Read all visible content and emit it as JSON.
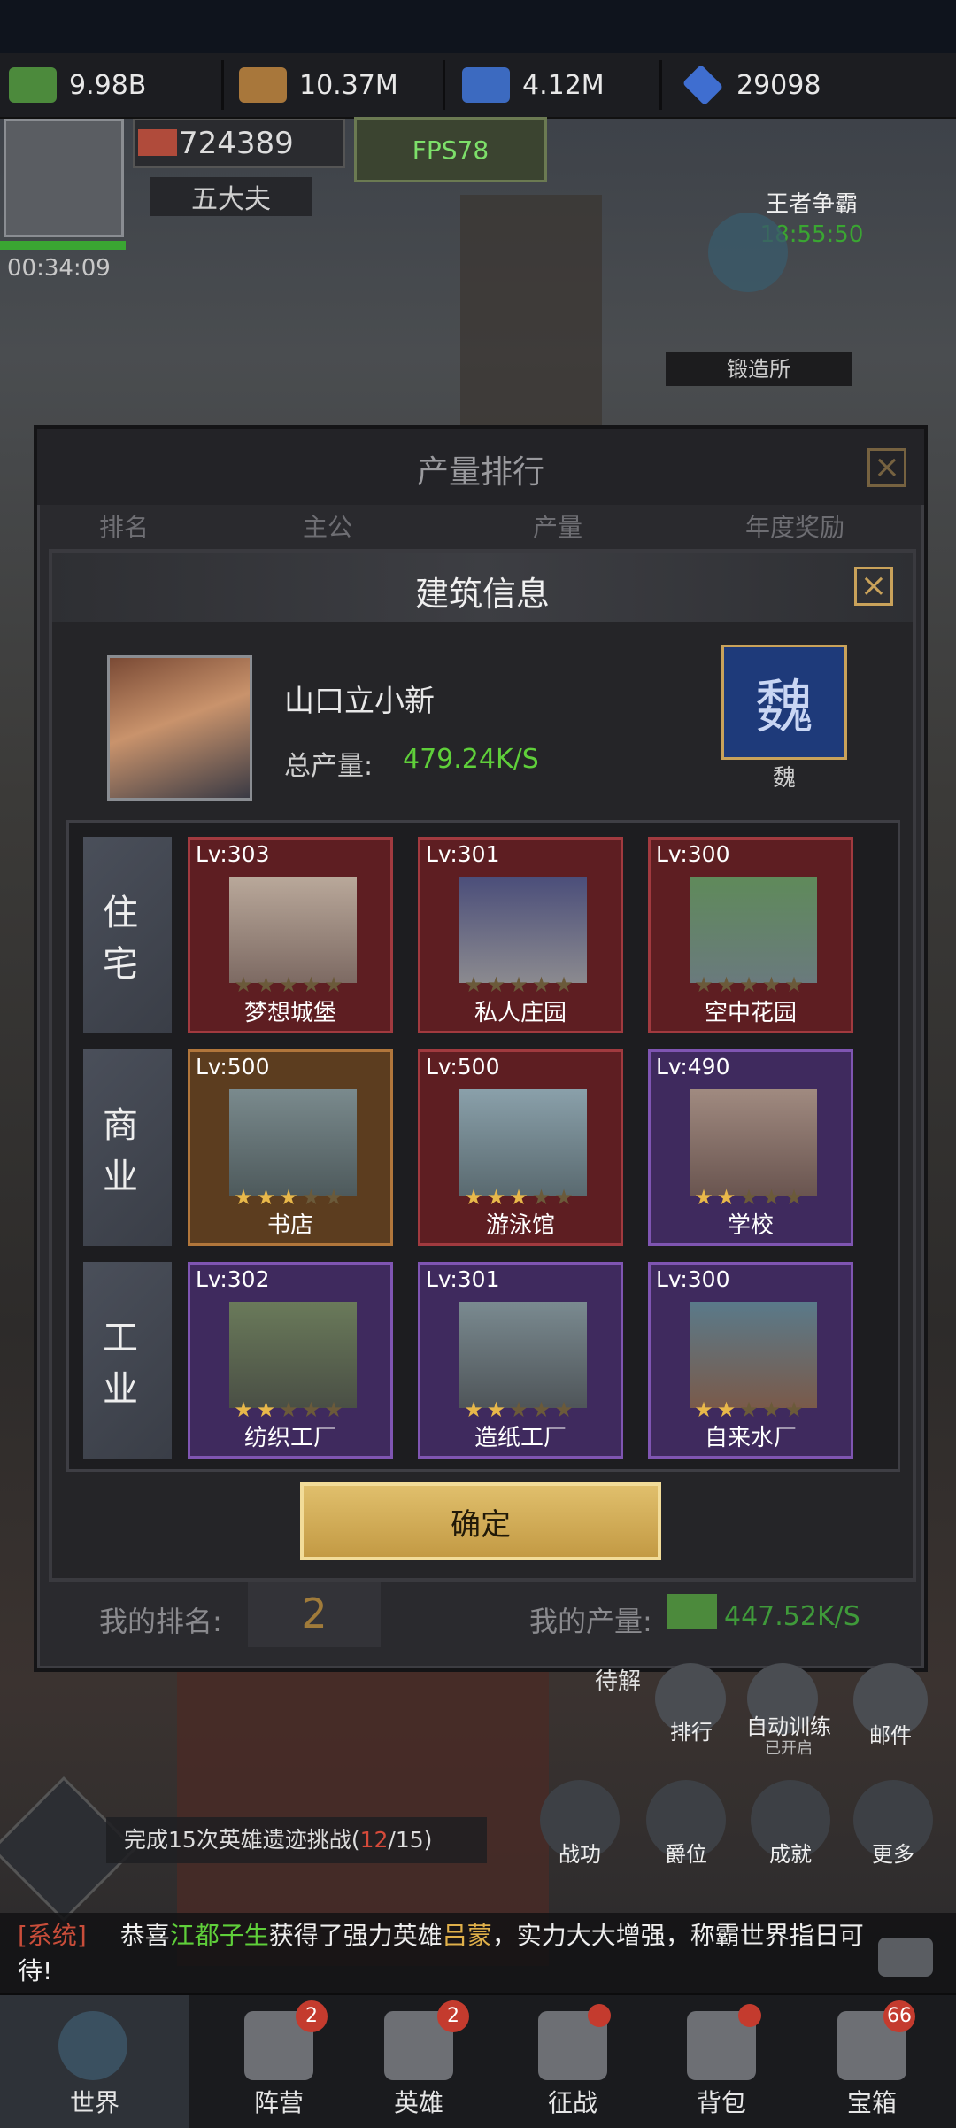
{
  "resources": [
    {
      "icon": "cash-icon",
      "value": "9.98B"
    },
    {
      "icon": "wheat-icon",
      "value": "10.37M"
    },
    {
      "icon": "lightning-icon",
      "value": "4.12M"
    },
    {
      "icon": "diamond-icon",
      "value": "29098"
    }
  ],
  "player": {
    "power": "724389",
    "rank_title": "五大夫",
    "timer": "00:34:09",
    "fps": "FPS78"
  },
  "world_events": {
    "king_title": "王者争霸",
    "king_timer": "18:55:50",
    "forge_label": "锻造所"
  },
  "rank_modal": {
    "title": "产量排行",
    "columns": [
      "排名",
      "主公",
      "产量",
      "年度奖励"
    ],
    "my_rank_label": "我的排名:",
    "my_rank_value": "2",
    "my_output_label": "我的产量:",
    "my_output_value": "447.52K/S"
  },
  "building_modal": {
    "title": "建筑信息",
    "player_name": "山口立小新",
    "total_output_label": "总产量:",
    "total_output_value": "479.24K/S",
    "faction_char": "魏",
    "faction_label": "魏",
    "confirm_label": "确定",
    "categories": [
      {
        "label": "住宅",
        "buildings": [
          {
            "level": "Lv:303",
            "name": "梦想城堡",
            "stars": 0,
            "tier": "red"
          },
          {
            "level": "Lv:301",
            "name": "私人庄园",
            "stars": 0,
            "tier": "red"
          },
          {
            "level": "Lv:300",
            "name": "空中花园",
            "stars": 0,
            "tier": "red"
          }
        ]
      },
      {
        "label": "商业",
        "buildings": [
          {
            "level": "Lv:500",
            "name": "书店",
            "stars": 3,
            "tier": "brown"
          },
          {
            "level": "Lv:500",
            "name": "游泳馆",
            "stars": 3,
            "tier": "red"
          },
          {
            "level": "Lv:490",
            "name": "学校",
            "stars": 2,
            "tier": "purple"
          }
        ]
      },
      {
        "label": "工业",
        "buildings": [
          {
            "level": "Lv:302",
            "name": "纺织工厂",
            "stars": 2,
            "tier": "purple"
          },
          {
            "level": "Lv:301",
            "name": "造纸工厂",
            "stars": 2,
            "tier": "purple"
          },
          {
            "level": "Lv:300",
            "name": "自来水厂",
            "stars": 2,
            "tier": "purple"
          }
        ]
      }
    ]
  },
  "side_buttons": [
    {
      "icon": "ranking-icon",
      "label": "排行"
    },
    {
      "icon": "auto-train-icon",
      "label": "自动训练",
      "sub": "已开启"
    },
    {
      "icon": "mail-icon",
      "label": "邮件"
    },
    {
      "icon": "battle-merit-icon",
      "label": "战功"
    },
    {
      "icon": "nobility-icon",
      "label": "爵位"
    },
    {
      "icon": "achievement-icon",
      "label": "成就"
    },
    {
      "icon": "more-icon",
      "label": "更多"
    }
  ],
  "quest": {
    "text": "完成15次英雄遗迹挑战",
    "progress": "(12/15)",
    "current": "12",
    "total": "15"
  },
  "misc_labels": {
    "pending": "待解"
  },
  "chat": {
    "tag": "[系统]",
    "prefix": "恭喜",
    "player": "江都子生",
    "middle": "获得了强力英雄",
    "hero": "吕蒙",
    "suffix": "，实力大大增强，称霸世界指日可待!"
  },
  "bottom_nav": [
    {
      "icon": "world-icon",
      "label": "世界",
      "badge": ""
    },
    {
      "icon": "camp-icon",
      "label": "阵营",
      "badge": "2"
    },
    {
      "icon": "hero-icon",
      "label": "英雄",
      "badge": "2"
    },
    {
      "icon": "expedition-icon",
      "label": "征战",
      "badge": ""
    },
    {
      "icon": "backpack-icon",
      "label": "背包",
      "badge": ""
    },
    {
      "icon": "treasure-icon",
      "label": "宝箱",
      "badge": "66"
    }
  ],
  "colors": {
    "gold": "#c9a25a",
    "green_text": "#5fcf3a",
    "red_card": "#5e1e22",
    "purple_card": "#3f2a5e",
    "brown_card": "#5c3d1f"
  }
}
